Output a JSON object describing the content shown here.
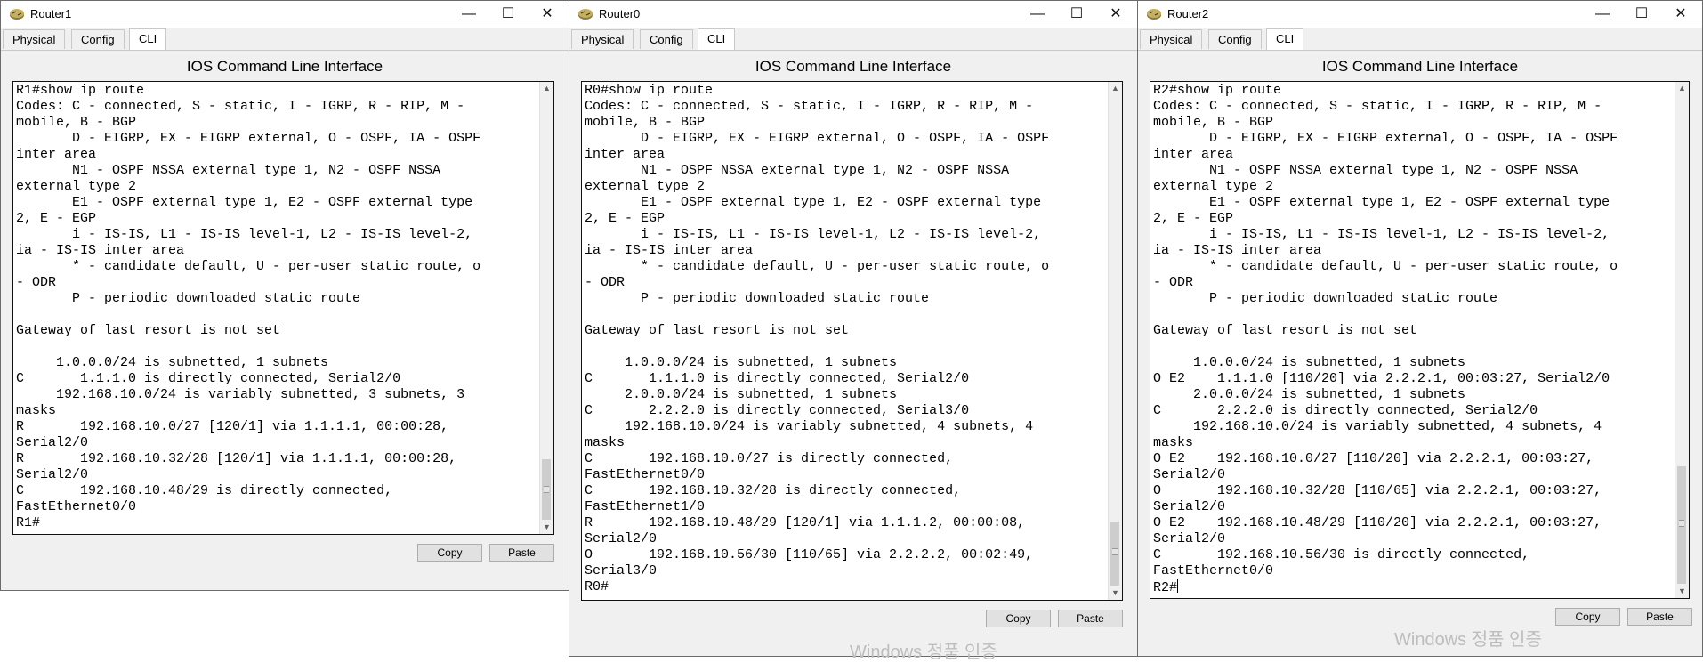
{
  "windows": [
    {
      "title": "Router1",
      "tabs": [
        "Physical",
        "Config",
        "CLI"
      ],
      "heading": "IOS Command Line Interface",
      "copy_label": "Copy",
      "paste_label": "Paste",
      "terminal_lines": [
        "R1#show ip route",
        "Codes: C - connected, S - static, I - IGRP, R - RIP, M -",
        "mobile, B - BGP",
        "       D - EIGRP, EX - EIGRP external, O - OSPF, IA - OSPF",
        "inter area",
        "       N1 - OSPF NSSA external type 1, N2 - OSPF NSSA",
        "external type 2",
        "       E1 - OSPF external type 1, E2 - OSPF external type",
        "2, E - EGP",
        "       i - IS-IS, L1 - IS-IS level-1, L2 - IS-IS level-2,",
        "ia - IS-IS inter area",
        "       * - candidate default, U - per-user static route, o",
        "- ODR",
        "       P - periodic downloaded static route",
        "",
        "Gateway of last resort is not set",
        "",
        "     1.0.0.0/24 is subnetted, 1 subnets",
        "C       1.1.1.0 is directly connected, Serial2/0",
        "     192.168.10.0/24 is variably subnetted, 3 subnets, 3",
        "masks",
        "R       192.168.10.0/27 [120/1] via 1.1.1.1, 00:00:28,",
        "Serial2/0",
        "R       192.168.10.32/28 [120/1] via 1.1.1.1, 00:00:28,",
        "Serial2/0",
        "C       192.168.10.48/29 is directly connected,",
        "FastEthernet0/0",
        "R1#"
      ]
    },
    {
      "title": "Router0",
      "tabs": [
        "Physical",
        "Config",
        "CLI"
      ],
      "heading": "IOS Command Line Interface",
      "copy_label": "Copy",
      "paste_label": "Paste",
      "terminal_lines": [
        "R0#show ip route",
        "Codes: C - connected, S - static, I - IGRP, R - RIP, M -",
        "mobile, B - BGP",
        "       D - EIGRP, EX - EIGRP external, O - OSPF, IA - OSPF",
        "inter area",
        "       N1 - OSPF NSSA external type 1, N2 - OSPF NSSA",
        "external type 2",
        "       E1 - OSPF external type 1, E2 - OSPF external type",
        "2, E - EGP",
        "       i - IS-IS, L1 - IS-IS level-1, L2 - IS-IS level-2,",
        "ia - IS-IS inter area",
        "       * - candidate default, U - per-user static route, o",
        "- ODR",
        "       P - periodic downloaded static route",
        "",
        "Gateway of last resort is not set",
        "",
        "     1.0.0.0/24 is subnetted, 1 subnets",
        "C       1.1.1.0 is directly connected, Serial2/0",
        "     2.0.0.0/24 is subnetted, 1 subnets",
        "C       2.2.2.0 is directly connected, Serial3/0",
        "     192.168.10.0/24 is variably subnetted, 4 subnets, 4",
        "masks",
        "C       192.168.10.0/27 is directly connected,",
        "FastEthernet0/0",
        "C       192.168.10.32/28 is directly connected,",
        "FastEthernet1/0",
        "R       192.168.10.48/29 [120/1] via 1.1.1.2, 00:00:08,",
        "Serial2/0",
        "O       192.168.10.56/30 [110/65] via 2.2.2.2, 00:02:49,",
        "Serial3/0",
        "R0#"
      ]
    },
    {
      "title": "Router2",
      "tabs": [
        "Physical",
        "Config",
        "CLI"
      ],
      "heading": "IOS Command Line Interface",
      "copy_label": "Copy",
      "paste_label": "Paste",
      "terminal_lines": [
        "R2#show ip route",
        "Codes: C - connected, S - static, I - IGRP, R - RIP, M -",
        "mobile, B - BGP",
        "       D - EIGRP, EX - EIGRP external, O - OSPF, IA - OSPF",
        "inter area",
        "       N1 - OSPF NSSA external type 1, N2 - OSPF NSSA",
        "external type 2",
        "       E1 - OSPF external type 1, E2 - OSPF external type",
        "2, E - EGP",
        "       i - IS-IS, L1 - IS-IS level-1, L2 - IS-IS level-2,",
        "ia - IS-IS inter area",
        "       * - candidate default, U - per-user static route, o",
        "- ODR",
        "       P - periodic downloaded static route",
        "",
        "Gateway of last resort is not set",
        "",
        "     1.0.0.0/24 is subnetted, 1 subnets",
        "O E2    1.1.1.0 [110/20] via 2.2.2.1, 00:03:27, Serial2/0",
        "     2.0.0.0/24 is subnetted, 1 subnets",
        "C       2.2.2.0 is directly connected, Serial2/0",
        "     192.168.10.0/24 is variably subnetted, 4 subnets, 4",
        "masks",
        "O E2    192.168.10.0/27 [110/20] via 2.2.2.1, 00:03:27,",
        "Serial2/0",
        "O       192.168.10.32/28 [110/65] via 2.2.2.1, 00:03:27,",
        "Serial2/0",
        "O E2    192.168.10.48/29 [110/20] via 2.2.2.1, 00:03:27,",
        "Serial2/0",
        "C       192.168.10.56/30 is directly connected,",
        "FastEthernet0/0",
        "R2#"
      ]
    }
  ],
  "watermarks": {
    "activation_text_1": "Windows 정품 인증",
    "activation_text_2": "Windows 정품 인증"
  },
  "colors": {
    "terminal_bg": "#ffffff",
    "panel_bg": "#f0f0f0",
    "border": "#111111"
  }
}
